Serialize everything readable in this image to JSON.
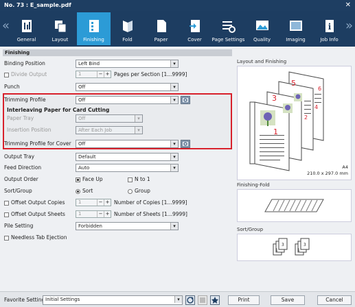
{
  "window": {
    "title": "No. 73 : E_sample.pdf",
    "close": "✕"
  },
  "tabs": [
    {
      "label": "General"
    },
    {
      "label": "Layout"
    },
    {
      "label": "Finishing"
    },
    {
      "label": "Fold"
    },
    {
      "label": "Paper"
    },
    {
      "label": "Cover"
    },
    {
      "label": "Page Settings"
    },
    {
      "label": "Quality"
    },
    {
      "label": "Imaging"
    },
    {
      "label": "Job Info"
    }
  ],
  "nav": {
    "prev": "«",
    "next": "»"
  },
  "section": "Finishing",
  "form": {
    "binding_position": {
      "label": "Binding Position",
      "value": "Left Bind"
    },
    "divide_output": {
      "label": "Divide Output",
      "value": "1",
      "pages_label": "Pages per Section [1...9999]"
    },
    "punch": {
      "label": "Punch",
      "value": "Off"
    },
    "trimming_profile": {
      "label": "Trimming Profile",
      "value": "Off"
    },
    "interleaving": {
      "heading": "Interleaving Paper for Card Cutting",
      "paper_tray_label": "Paper Tray",
      "paper_tray_value": "Off",
      "insertion_label": "Insertion Position",
      "insertion_value": "After Each Job"
    },
    "trimming_cover": {
      "label": "Trimming Profile for Cover",
      "value": "Off"
    },
    "output_tray": {
      "label": "Output Tray",
      "value": "Default"
    },
    "feed_direction": {
      "label": "Feed Direction",
      "value": "Auto"
    },
    "output_order": {
      "label": "Output Order",
      "face_up": "Face Up",
      "n_to_1": "N to 1"
    },
    "sort_group": {
      "label": "Sort/Group",
      "sort": "Sort",
      "group": "Group"
    },
    "offset_copies": {
      "label": "Offset Output Copies",
      "value": "1",
      "suffix": "Number of Copies [1...9999]"
    },
    "offset_sheets": {
      "label": "Offset Output Sheets",
      "value": "1",
      "suffix": "Number of Sheets [1...9999]"
    },
    "pile_setting": {
      "label": "Pile Setting",
      "value": "Forbidden"
    },
    "needless_tab": {
      "label": "Needless Tab Ejection"
    }
  },
  "spin": {
    "minus": "−",
    "plus": "+"
  },
  "preview": {
    "layout_title": "Layout and Finishing",
    "pages": [
      "1",
      "3",
      "5",
      "2",
      "4",
      "6"
    ],
    "paper": "A4",
    "size": "210.0 x 297.0 mm",
    "fold_title": "Finishing-Fold",
    "sort_title": "Sort/Group"
  },
  "bottom": {
    "favorite_label": "Favorite Setting",
    "favorite_value": "Initial Settings",
    "print": "Print",
    "save": "Save",
    "cancel": "Cancel"
  }
}
